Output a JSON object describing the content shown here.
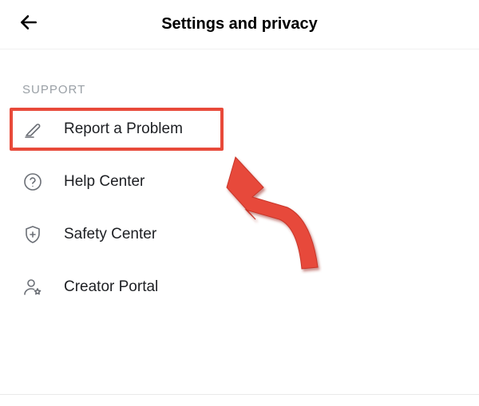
{
  "header": {
    "title": "Settings and privacy"
  },
  "section": {
    "label": "SUPPORT",
    "items": [
      {
        "icon": "pencil-edit-icon",
        "label": "Report a Problem",
        "highlighted": true
      },
      {
        "icon": "help-circle-icon",
        "label": "Help Center",
        "highlighted": false
      },
      {
        "icon": "shield-plus-icon",
        "label": "Safety Center",
        "highlighted": false
      },
      {
        "icon": "person-star-icon",
        "label": "Creator Portal",
        "highlighted": false
      }
    ]
  },
  "annotation": {
    "type": "arrow",
    "color": "#e84a3a",
    "target": "report-a-problem-item"
  }
}
